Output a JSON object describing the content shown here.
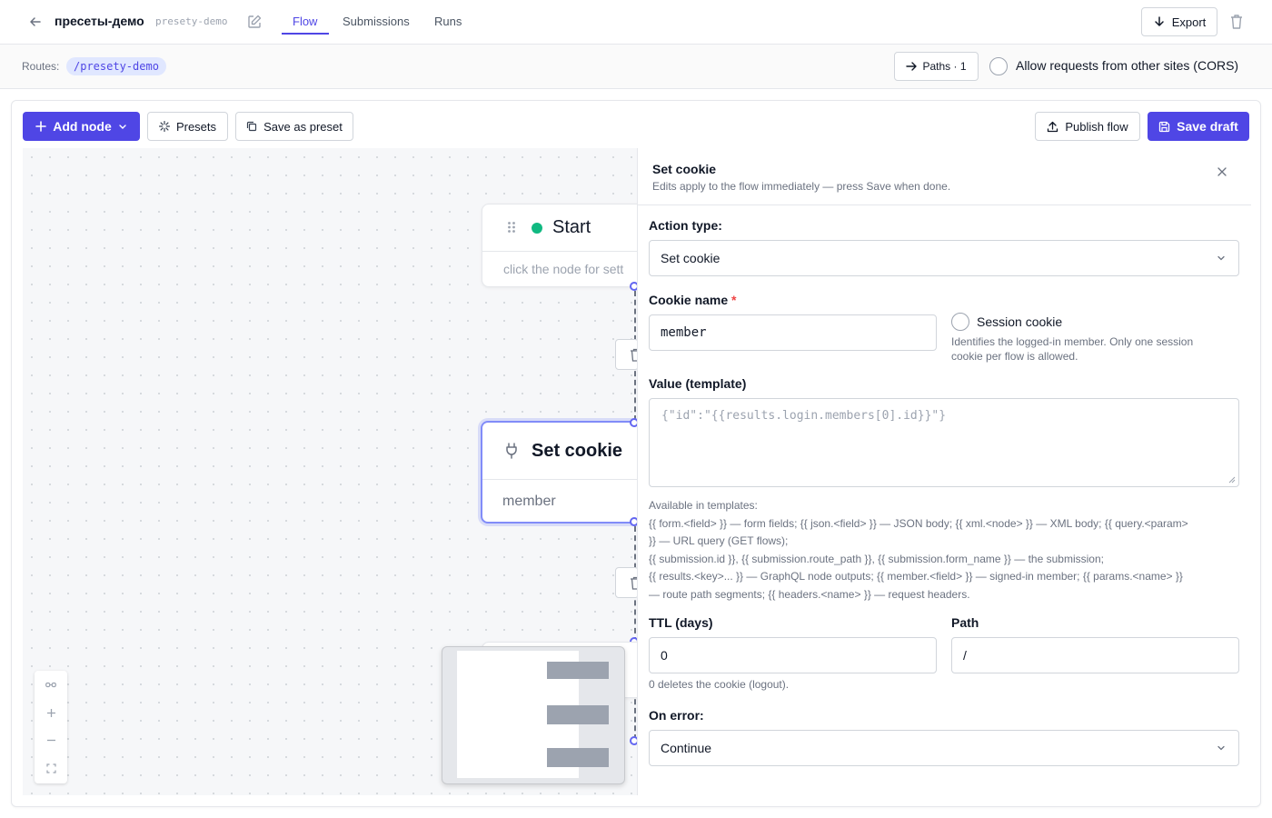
{
  "header": {
    "title": "пресеты-демо",
    "slug": "presety-demo",
    "tabs": [
      {
        "label": "Flow",
        "active": true
      },
      {
        "label": "Submissions",
        "active": false
      },
      {
        "label": "Runs",
        "active": false
      }
    ],
    "export_label": "Export"
  },
  "routes_bar": {
    "label": "Routes:",
    "route": "/presety-demo",
    "paths_label": "Paths · 1",
    "cors_label": "Allow requests from other sites (CORS)",
    "cors_checked": false
  },
  "toolbar": {
    "add_node_label": "Add node",
    "presets_label": "Presets",
    "save_as_preset_label": "Save as preset",
    "publish_label": "Publish flow",
    "save_draft_label": "Save draft"
  },
  "canvas": {
    "nodes": [
      {
        "title": "Start",
        "subtitle": "click the node for sett",
        "status_color": "#10b981"
      },
      {
        "title": "Set cookie",
        "subtitle": "member",
        "selected": true
      }
    ]
  },
  "panel": {
    "title": "Set cookie",
    "description": "Edits apply to the flow immediately — press Save when done.",
    "action_type_label": "Action type:",
    "action_type_value": "Set cookie",
    "cookie_name_label": "Cookie name",
    "required_mark": "*",
    "cookie_name_value": "member",
    "session_cookie_label": "Session cookie",
    "session_cookie_checked": false,
    "session_cookie_hint_1": "Identifies the logged-in member. Only one session",
    "session_cookie_hint_2": "cookie per flow is allowed.",
    "value_label": "Value (template)",
    "value_placeholder": "{\"id\":\"{{results.login.members[0].id}}\"}",
    "help_lines": [
      "Available in templates:",
      "{{ form.<field> }} — form fields; {{ json.<field> }} — JSON body; {{ xml.<node> }} — XML body; {{ query.<param>",
      "}} — URL query (GET flows);",
      "{{ submission.id }}, {{ submission.route_path }}, {{ submission.form_name }} — the submission;",
      "{{ results.<key>... }} — GraphQL node outputs; {{ member.<field> }} — signed-in member; {{ params.<name> }}",
      "— route path segments; {{ headers.<name> }} — request headers."
    ],
    "ttl_label": "TTL (days)",
    "ttl_value": "0",
    "ttl_hint": "0 deletes the cookie (logout).",
    "path_label": "Path",
    "path_value": "/",
    "on_error_label": "On error:",
    "on_error_value": "Continue"
  },
  "colors": {
    "accent": "#4f46e5",
    "accent_light": "#e0e7ff",
    "status_green": "#10b981",
    "required_red": "#ef4444"
  },
  "icons": [
    "arrow-left-icon",
    "edit-icon",
    "download-icon",
    "trash-icon",
    "arrow-right-icon",
    "plus-icon",
    "sparkle-icon",
    "copy-icon",
    "upload-icon",
    "save-icon",
    "close-icon",
    "chevron-down-icon",
    "grip-icon",
    "plug-icon",
    "fit-view-icon",
    "zoom-in-icon",
    "zoom-out-icon",
    "fullscreen-icon"
  ]
}
